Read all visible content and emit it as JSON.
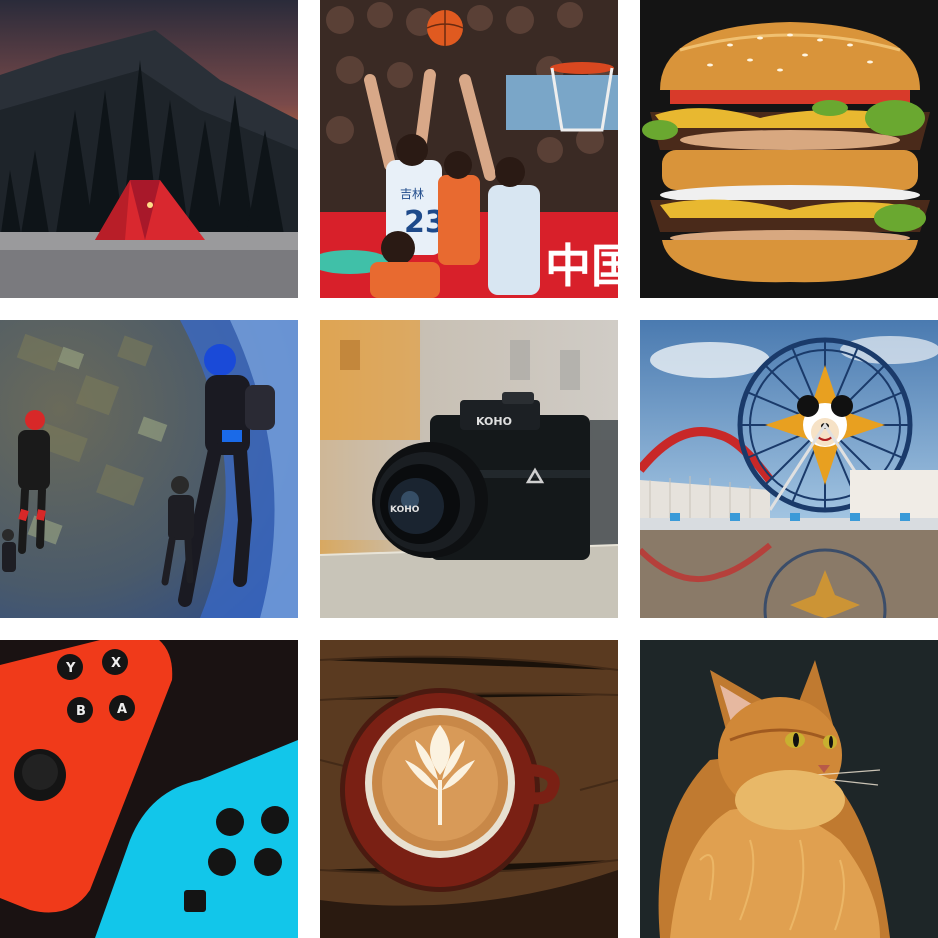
{
  "gallery": {
    "tiles": [
      {
        "subject": "mountain-tent-sunset",
        "colors": {
          "sky_top": "#2a2b3a",
          "sky_glow": "#f2762a",
          "tent": "#d9282f"
        }
      },
      {
        "subject": "basketball-game",
        "text": {
          "jersey_number": "23",
          "jersey_chars": "吉林",
          "banner_chars": "中国"
        },
        "colors": {
          "banner": "#d8202a",
          "jersey": "#e8f0f8"
        }
      },
      {
        "subject": "double-cheeseburger",
        "colors": {
          "bun": "#d9943a",
          "background": "#141414"
        }
      },
      {
        "subject": "skydivers",
        "colors": {
          "ground": "#4a5a6a",
          "horizon": "#3a6ac8"
        }
      },
      {
        "subject": "camera",
        "text": {
          "brand_top": "KOHO",
          "brand_lens": "KOHO"
        },
        "colors": {
          "body": "#14181a",
          "ledge": "#c8c4b8"
        }
      },
      {
        "subject": "ferris-wheel",
        "colors": {
          "sky": "#6fa3cf",
          "wheel": "#1a3a6a",
          "coaster": "#c82828"
        }
      },
      {
        "subject": "switch-controllers",
        "text": {
          "btn_y": "Y",
          "btn_x": "X",
          "btn_b": "B",
          "btn_a": "A"
        },
        "colors": {
          "neon_red": "#f03a1a",
          "neon_blue": "#12c6ea"
        }
      },
      {
        "subject": "latte-art",
        "colors": {
          "table": "#5a3a20",
          "cup": "#7a2014",
          "foam": "#e8c08a"
        }
      },
      {
        "subject": "maine-coon-cat",
        "colors": {
          "background": "#1e2628",
          "fur": "#d08838"
        }
      }
    ]
  }
}
